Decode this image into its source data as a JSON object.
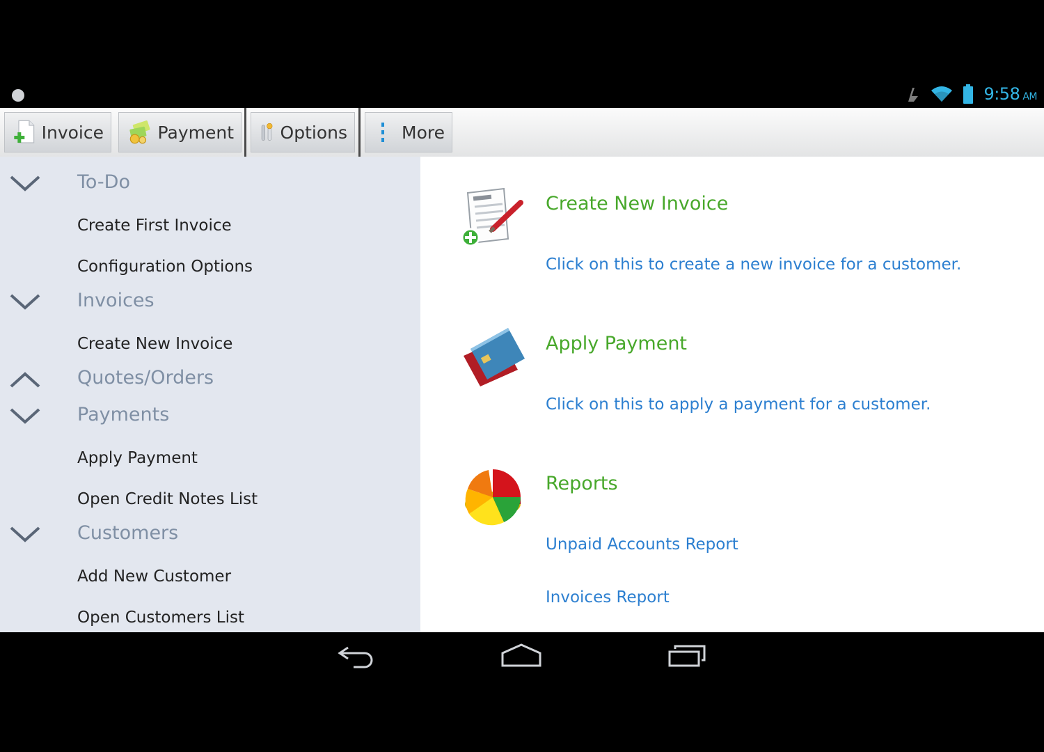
{
  "status": {
    "time": "9:58",
    "ampm": "AM",
    "icons": [
      "notification-icon",
      "signal-icon",
      "wifi-icon",
      "battery-icon"
    ]
  },
  "toolbar": {
    "invoice_label": "Invoice",
    "payment_label": "Payment",
    "options_label": "Options",
    "more_label": "More"
  },
  "sidebar": {
    "todo": {
      "label": "To-Do",
      "items": [
        "Create First Invoice",
        "Configuration Options"
      ]
    },
    "invoices": {
      "label": "Invoices",
      "items": [
        "Create New Invoice"
      ]
    },
    "quotes": {
      "label": "Quotes/Orders"
    },
    "payments": {
      "label": "Payments",
      "items": [
        "Apply Payment",
        "Open Credit Notes List"
      ]
    },
    "customers": {
      "label": "Customers",
      "items": [
        "Add New Customer",
        "Open Customers List"
      ]
    }
  },
  "main": {
    "invoice": {
      "title": "Create New Invoice",
      "desc": "Click on this to create a new invoice for a customer."
    },
    "payment": {
      "title": "Apply Payment",
      "desc": "Click on this to apply a payment for a customer."
    },
    "reports": {
      "title": "Reports",
      "links": [
        "Unpaid Accounts Report",
        "Invoices Report"
      ]
    }
  },
  "colors": {
    "accent_blue": "#33b5e5",
    "title_green": "#48a82b",
    "link_blue": "#2c7fd0",
    "sidebar_bg": "#e3e7ef",
    "section_gray": "#7f8fa4"
  }
}
